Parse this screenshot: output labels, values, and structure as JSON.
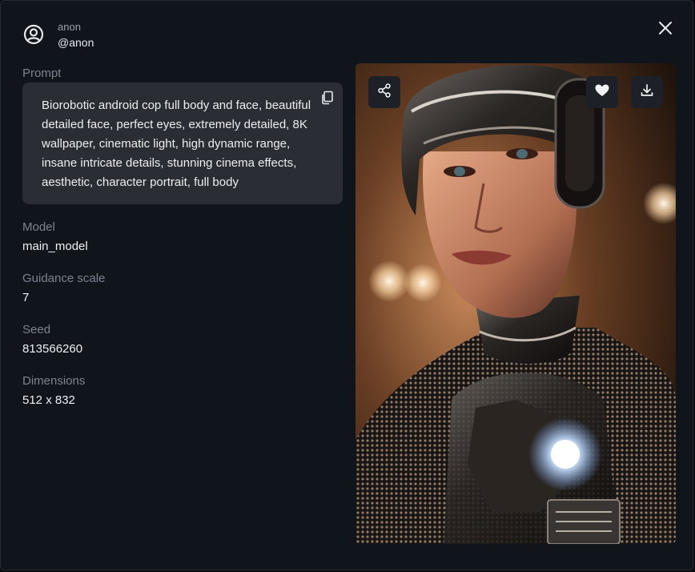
{
  "user": {
    "name": "anon",
    "handle": "@anon"
  },
  "prompt": {
    "label": "Prompt",
    "text": "Biorobotic android cop full body and face, beautiful detailed face, perfect eyes, extremely detailed, 8K wallpaper, cinematic light, high dynamic range, insane intricate details, stunning cinema effects, aesthetic, character portrait, full body"
  },
  "details": {
    "model_label": "Model",
    "model_value": "main_model",
    "guidance_label": "Guidance scale",
    "guidance_value": "7",
    "seed_label": "Seed",
    "seed_value": "813566260",
    "dimensions_label": "Dimensions",
    "dimensions_value": "512 x 832"
  },
  "image": {
    "alt": "Generated image: biorobotic android cop portrait"
  },
  "icons": {
    "user": "user-circle-icon",
    "close": "close-icon",
    "copy": "copy-icon",
    "share": "share-icon",
    "like": "heart-icon",
    "download": "download-icon"
  },
  "colors": {
    "modal_bg": "#10141b",
    "prompt_box_bg": "#2a2d33",
    "label": "#7d848f",
    "value": "#eef0f3",
    "image_button_bg": "#1d2026"
  }
}
